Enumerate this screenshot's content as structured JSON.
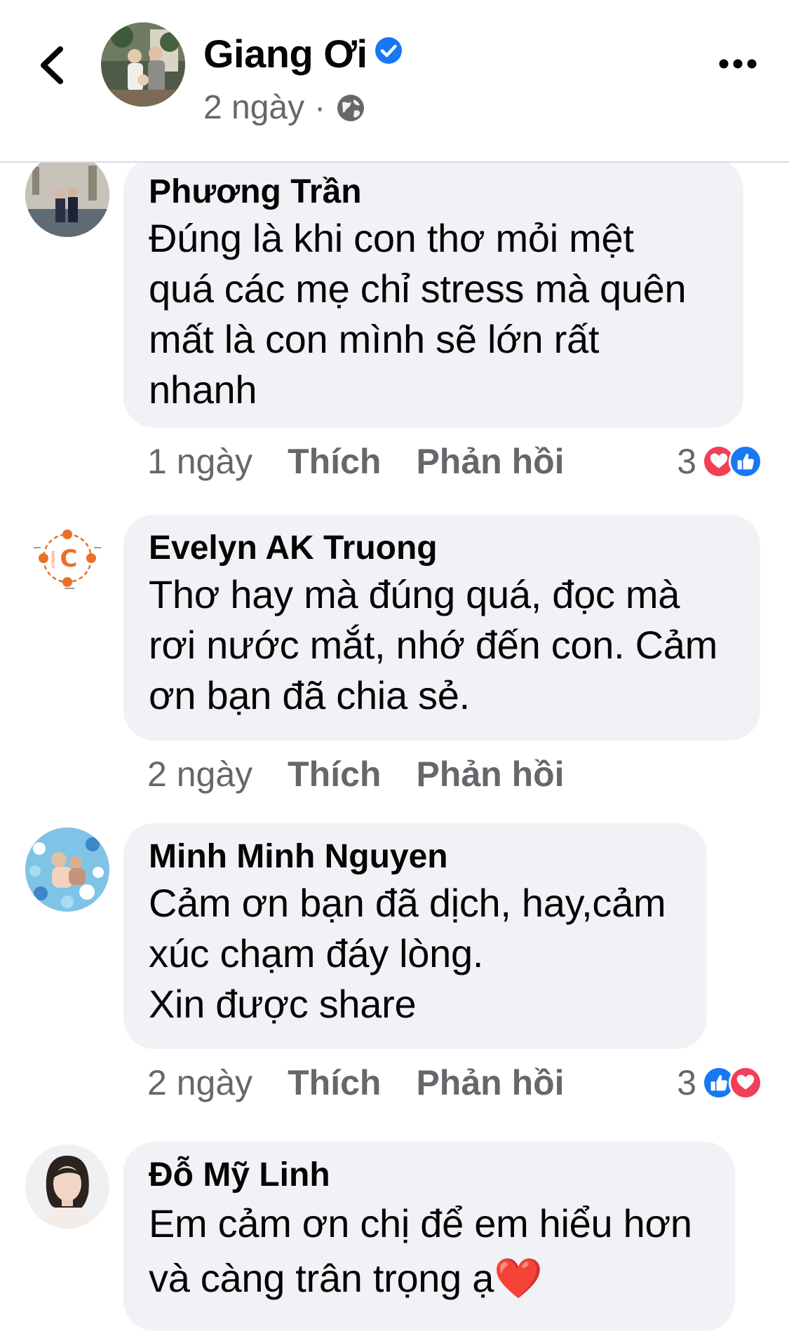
{
  "header": {
    "name": "Giang Ơi",
    "time": "2 ngày",
    "separator": "·",
    "back_icon": "chevron-left-icon",
    "verified_icon": "verified-badge-icon",
    "privacy_icon": "globe-icon",
    "more_icon": "more-dots-icon"
  },
  "colors": {
    "verified": "#1877f2",
    "like": "#1877f2",
    "love": "#f33e58",
    "bubble": "#f0f2f5",
    "meta": "#65676b"
  },
  "comments": [
    {
      "author": "Phương Trần",
      "lines": [
        "Đúng là khi con thơ mỏi mệt",
        "quá các mẹ chỉ stress mà quên",
        "mất là con mình sẽ lớn rất",
        "nhanh"
      ],
      "time": "1 ngày",
      "like": "Thích",
      "reply": "Phản hồi",
      "reaction_count": "3",
      "reactions": [
        "love",
        "like"
      ]
    },
    {
      "author": "Evelyn AK Truong",
      "lines": [
        "Thơ hay mà đúng quá, đọc mà",
        "rơi nước mắt, nhớ đến con. Cảm",
        "ơn bạn đã chia sẻ."
      ],
      "time": "2 ngày",
      "like": "Thích",
      "reply": "Phản hồi",
      "avatar_text": {
        "word": "VITAMIN",
        "letter": "C"
      }
    },
    {
      "author": "Minh Minh Nguyen",
      "lines": [
        "Cảm ơn bạn đã dịch, hay,cảm",
        "xúc chạm đáy lòng.",
        "Xin được share"
      ],
      "time": "2 ngày",
      "like": "Thích",
      "reply": "Phản hồi",
      "reaction_count": "3",
      "reactions": [
        "like",
        "love"
      ]
    },
    {
      "author": "Đỗ Mỹ Linh",
      "lines": [
        "Em cảm ơn chị để em hiểu hơn",
        "và càng trân trọng ạ❤️"
      ]
    }
  ]
}
